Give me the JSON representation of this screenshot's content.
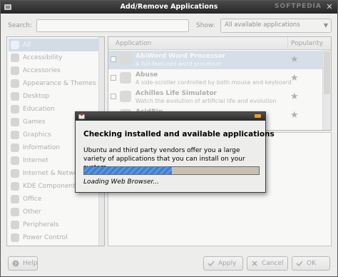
{
  "window": {
    "title": "Add/Remove Applications",
    "watermark": "SOFTPEDIA"
  },
  "search": {
    "label": "Search:",
    "value": ""
  },
  "show": {
    "label": "Show:",
    "selected": "All available applications"
  },
  "categories": [
    {
      "label": "All",
      "selected": true
    },
    {
      "label": "Accessibility"
    },
    {
      "label": "Accessories"
    },
    {
      "label": "Appearance & Themes"
    },
    {
      "label": "Desktop"
    },
    {
      "label": "Education"
    },
    {
      "label": "Games"
    },
    {
      "label": "Graphics"
    },
    {
      "label": "Information"
    },
    {
      "label": "Internet"
    },
    {
      "label": "Internet & Network"
    },
    {
      "label": "KDE Components"
    },
    {
      "label": "Office"
    },
    {
      "label": "Other"
    },
    {
      "label": "Peripherals"
    },
    {
      "label": "Power Control"
    }
  ],
  "app_list": {
    "col_application": "Application",
    "col_popularity": "Popularity",
    "rows": [
      {
        "name": "AbiWord Word Processor",
        "desc": "A full-featured word processor",
        "selected": true
      },
      {
        "name": "Abuse",
        "desc": "A side-scroller controlled by both mouse and keyboard"
      },
      {
        "name": "Achilles Life Simulator",
        "desc": "Watch the evolution of artificial life and evolution"
      },
      {
        "name": "AcidRip",
        "desc": ""
      }
    ]
  },
  "buttons": {
    "help": "Help",
    "apply": "Apply",
    "cancel": "Cancel",
    "ok": "OK"
  },
  "dialog": {
    "heading": "Checking installed and available applications",
    "body": "Ubuntu and third party vendors offer you a large variety of applications that you can install on your system.",
    "progress": 0.5,
    "status": "Loading Web Browser..."
  },
  "colors": {
    "accent": "#3f7fd0",
    "close": "#f19a26"
  }
}
